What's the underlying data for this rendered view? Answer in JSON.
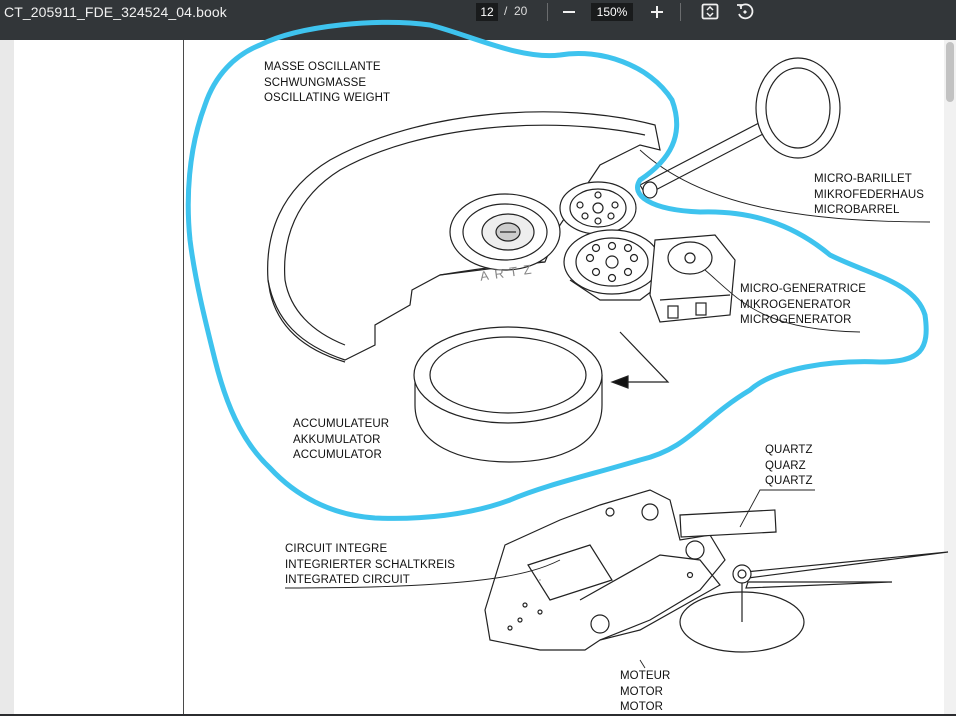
{
  "toolbar": {
    "document_title": "CT_205911_FDE_324524_04.book",
    "page_current": "12",
    "page_separator": "/",
    "page_total": "20",
    "zoom_out_icon": "minus-icon",
    "zoom_level": "150%",
    "zoom_in_icon": "plus-icon",
    "fit_page_icon": "fit-to-page-icon",
    "rotate_icon": "rotate-icon"
  },
  "diagram": {
    "labels": {
      "oscillating_weight": [
        "MASSE OSCILLANTE",
        "SCHWUNGMASSE",
        "OSCILLATING WEIGHT"
      ],
      "microbarrel": [
        "MICRO-BARILLET",
        "MIKROFEDERHAUS",
        "MICROBARREL"
      ],
      "microgenerator": [
        "MICRO-GENERATRICE",
        "MIKROGENERATOR",
        "MICROGENERATOR"
      ],
      "accumulator": [
        "ACCUMULATEUR",
        "AKKUMULATOR",
        "ACCUMULATOR"
      ],
      "quartz": [
        "QUARTZ",
        "QUARZ",
        "QUARTZ"
      ],
      "integrated_circuit": [
        "CIRCUIT INTEGRE",
        "INTEGRIERTER SCHALTKREIS",
        "INTEGRATED CIRCUIT"
      ],
      "motor": [
        "MOTEUR",
        "MOTOR",
        "MOTOR"
      ]
    },
    "weight_engraving": "ARTZ",
    "highlight_color": "#3ec3ee"
  }
}
